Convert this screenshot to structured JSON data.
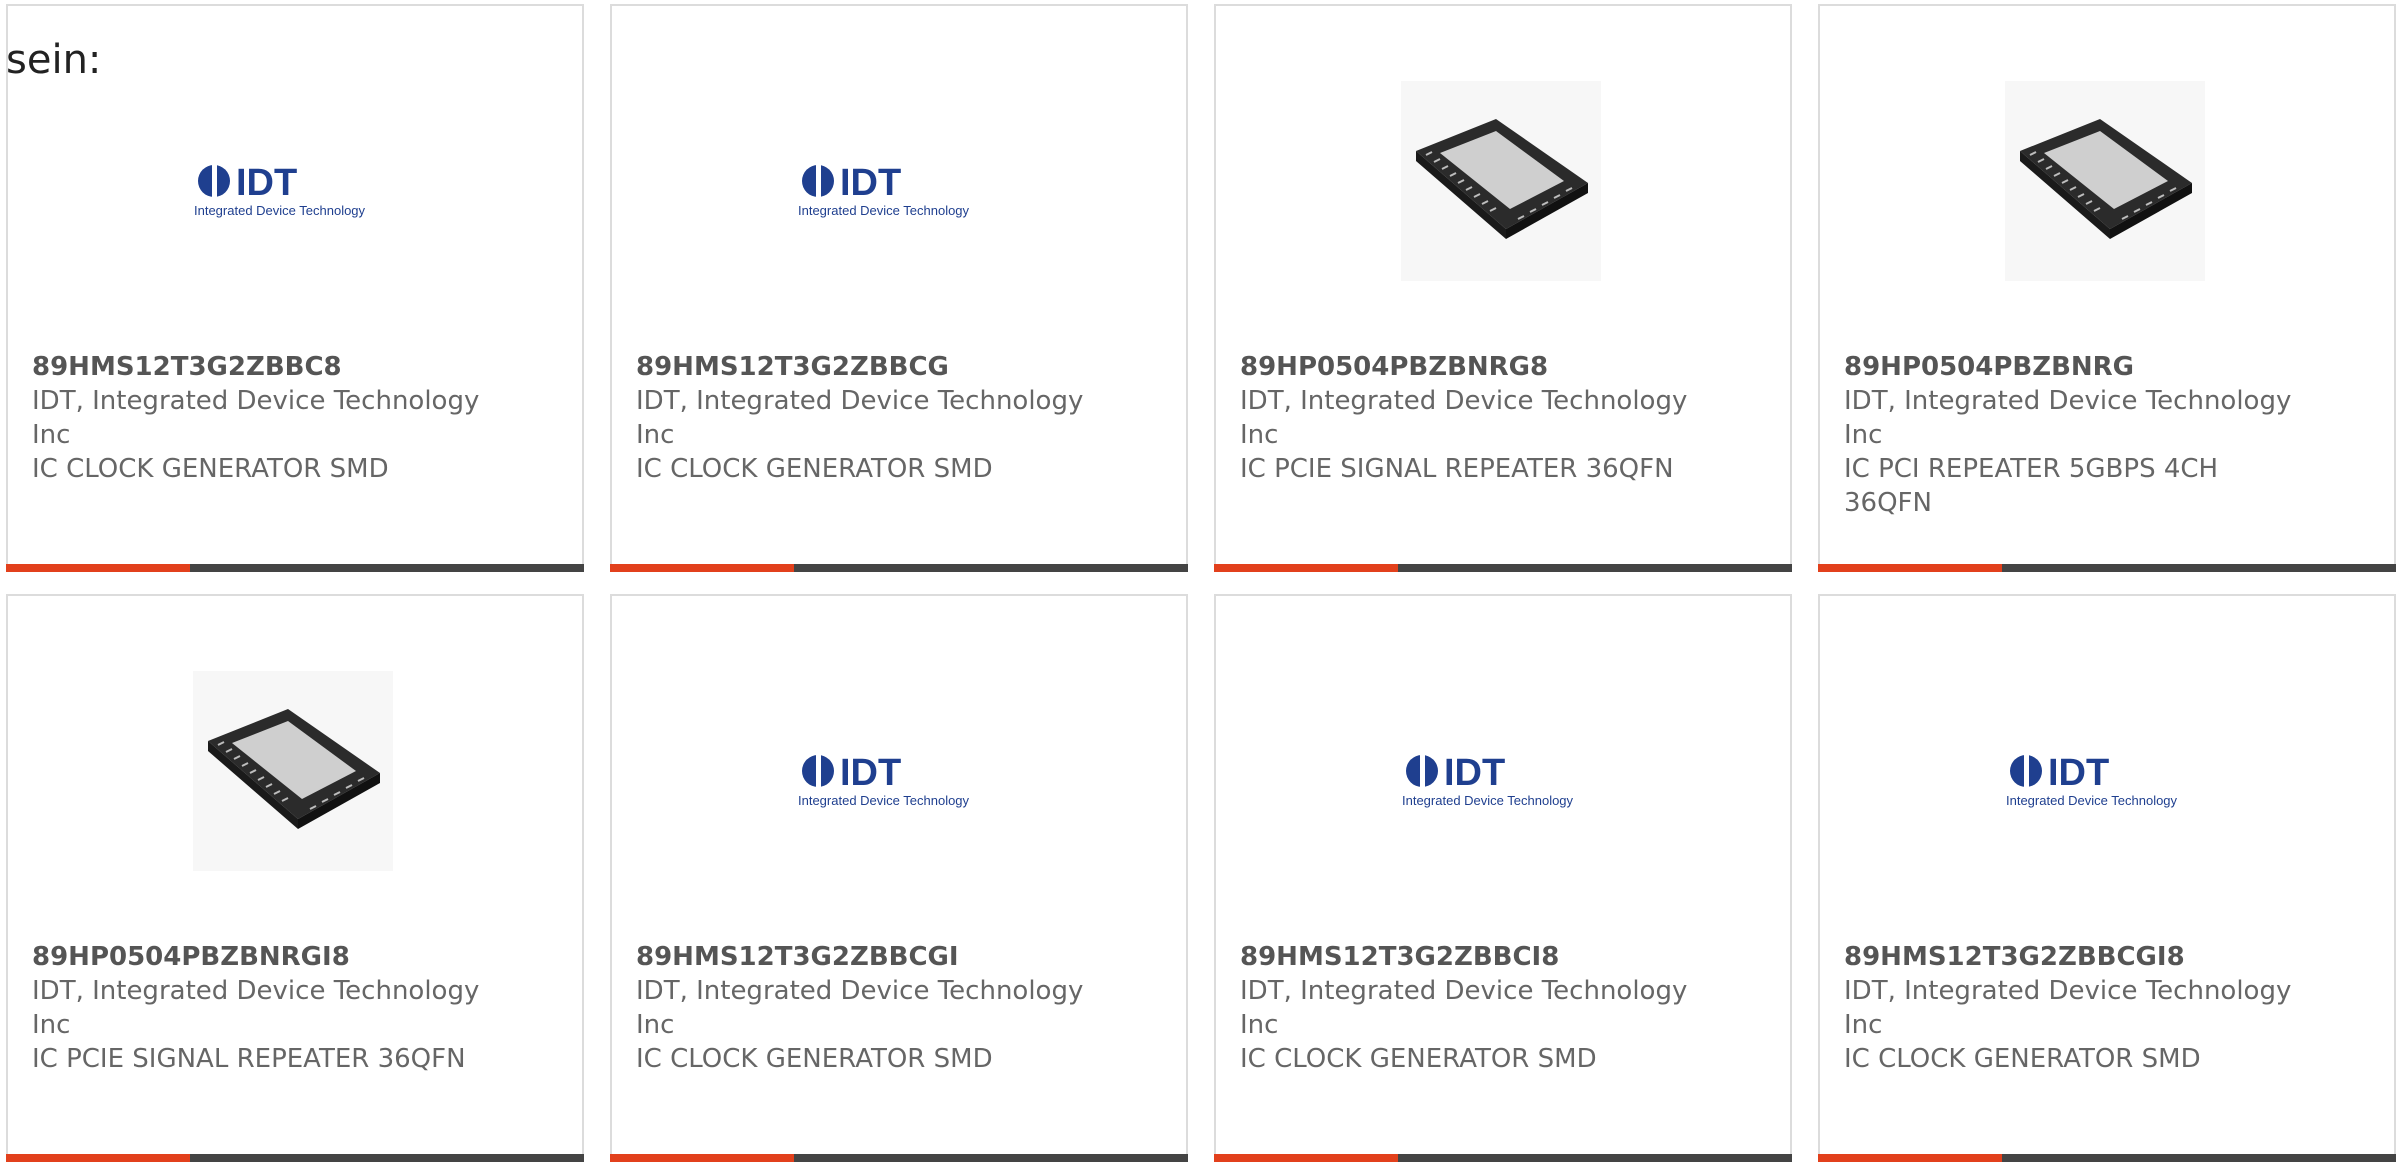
{
  "leadin": "sein:",
  "brand": {
    "accent": "#e2401c",
    "bar": "#444444",
    "logo_main": "IDT",
    "logo_sub": "Integrated Device Technology",
    "logo_color": "#1f3f8f"
  },
  "products": [
    {
      "part": "89HMS12T3G2ZBBC8",
      "maker": "IDT, Integrated Device Technology Inc",
      "desc": "IC CLOCK GENERATOR SMD",
      "image": "idt-logo"
    },
    {
      "part": "89HMS12T3G2ZBBCG",
      "maker": "IDT, Integrated Device Technology Inc",
      "desc": "IC CLOCK GENERATOR SMD",
      "image": "idt-logo"
    },
    {
      "part": "89HP0504PBZBNRG8",
      "maker": "IDT, Integrated Device Technology Inc",
      "desc": "IC PCIE SIGNAL REPEATER 36QFN",
      "image": "qfn-chip"
    },
    {
      "part": "89HP0504PBZBNRG",
      "maker": "IDT, Integrated Device Technology Inc",
      "desc": "IC PCI REPEATER 5GBPS 4CH 36QFN",
      "image": "qfn-chip"
    },
    {
      "part": "89HP0504PBZBNRGI8",
      "maker": "IDT, Integrated Device Technology Inc",
      "desc": "IC PCIE SIGNAL REPEATER 36QFN",
      "image": "qfn-chip"
    },
    {
      "part": "89HMS12T3G2ZBBCGI",
      "maker": "IDT, Integrated Device Technology Inc",
      "desc": "IC CLOCK GENERATOR SMD",
      "image": "idt-logo"
    },
    {
      "part": "89HMS12T3G2ZBBCI8",
      "maker": "IDT, Integrated Device Technology Inc",
      "desc": "IC CLOCK GENERATOR SMD",
      "image": "idt-logo"
    },
    {
      "part": "89HMS12T3G2ZBBCGI8",
      "maker": "IDT, Integrated Device Technology Inc",
      "desc": "IC CLOCK GENERATOR SMD",
      "image": "idt-logo"
    }
  ]
}
